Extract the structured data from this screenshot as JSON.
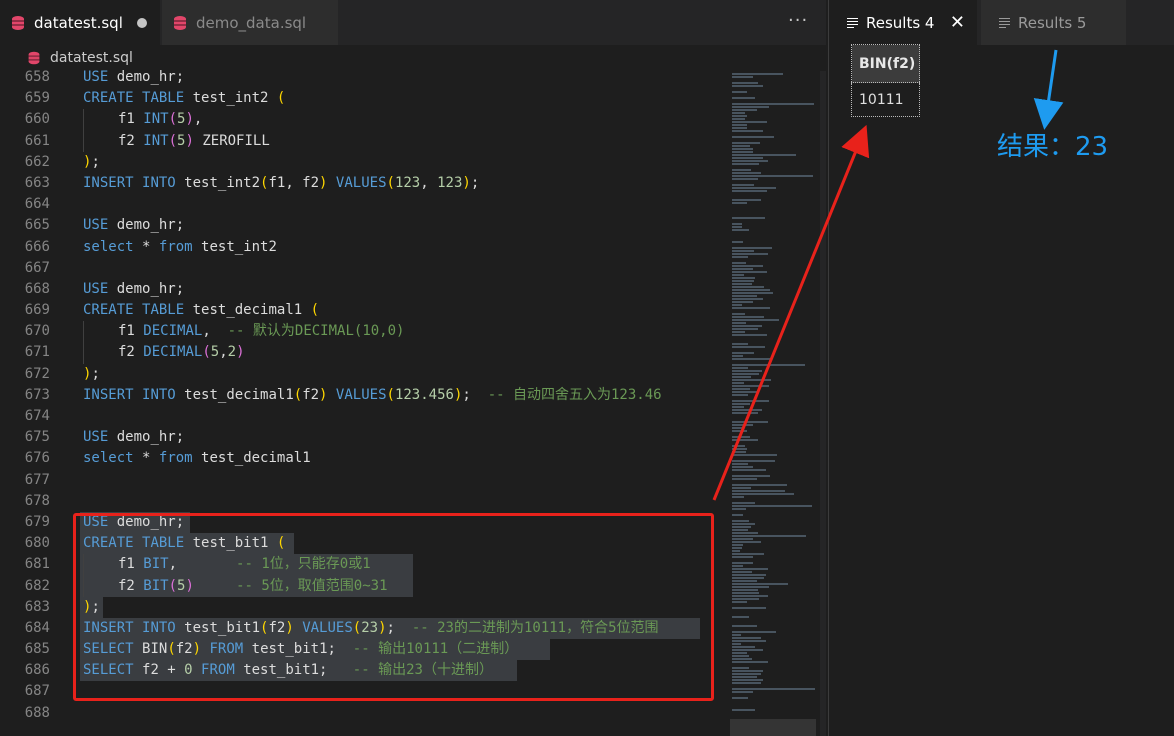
{
  "editor": {
    "tabs": [
      {
        "label": "datatest.sql",
        "active": true,
        "dirty": true
      },
      {
        "label": "demo_data.sql",
        "active": false
      }
    ],
    "more_icon": "more-actions-icon",
    "breadcrumb": "datatest.sql",
    "lines": [
      {
        "n": "658",
        "t": "USE demo_hr;"
      },
      {
        "n": "659",
        "t": "CREATE TABLE test_int2 ("
      },
      {
        "n": "660",
        "t": "f1 INT(5),"
      },
      {
        "n": "661",
        "t": "f2 INT(5) ZEROFILL"
      },
      {
        "n": "662",
        "t": ");"
      },
      {
        "n": "663",
        "t": "INSERT INTO test_int2(f1, f2) VALUES(123, 123);"
      },
      {
        "n": "664",
        "t": ""
      },
      {
        "n": "665",
        "t": "USE demo_hr;"
      },
      {
        "n": "666",
        "t": "select * from test_int2"
      },
      {
        "n": "667",
        "t": ""
      },
      {
        "n": "668",
        "t": "USE demo_hr;"
      },
      {
        "n": "669",
        "t": "CREATE TABLE test_decimal1 ("
      },
      {
        "n": "670",
        "t": "f1 DECIMAL,  -- 默认为DECIMAL(10,0)"
      },
      {
        "n": "671",
        "t": "f2 DECIMAL(5,2)"
      },
      {
        "n": "672",
        "t": ");"
      },
      {
        "n": "673",
        "t": "INSERT INTO test_decimal1(f2) VALUES(123.456);  -- 自动四舍五入为123.46"
      },
      {
        "n": "674",
        "t": ""
      },
      {
        "n": "675",
        "t": "USE demo_hr;"
      },
      {
        "n": "676",
        "t": "select * from test_decimal1"
      },
      {
        "n": "677",
        "t": ""
      },
      {
        "n": "678",
        "t": ""
      },
      {
        "n": "679",
        "t": "USE demo_hr;"
      },
      {
        "n": "680",
        "t": "CREATE TABLE test_bit1 ("
      },
      {
        "n": "681",
        "t": "f1 BIT,       -- 1位，只能存0或1"
      },
      {
        "n": "682",
        "t": "f2 BIT(5)     -- 5位，取值范围0~31"
      },
      {
        "n": "683",
        "t": ");"
      },
      {
        "n": "684",
        "t": "INSERT INTO test_bit1(f2) VALUES(23);  -- 23的二进制为10111，符合5位范围"
      },
      {
        "n": "685",
        "t": "SELECT BIN(f2) FROM test_bit1;  -- 输出10111（二进制）"
      },
      {
        "n": "686",
        "t": "SELECT f2 + 0 FROM test_bit1;   -- 输出23（十进制）"
      },
      {
        "n": "687",
        "t": ""
      },
      {
        "n": "688",
        "t": ""
      }
    ]
  },
  "results": {
    "tabs": [
      {
        "label": "Results 4",
        "active": true
      },
      {
        "label": "Results 5",
        "active": false
      }
    ],
    "grid": {
      "columns": [
        "BIN(f2)"
      ],
      "rows": [
        [
          "10111"
        ]
      ]
    },
    "annotation": "结果：23"
  },
  "colors": {
    "keyword": "#569cd6",
    "comment": "#6a9955",
    "number": "#b5cea8",
    "highlight_box": "#e8221b",
    "annotation": "#1e9bf0"
  }
}
